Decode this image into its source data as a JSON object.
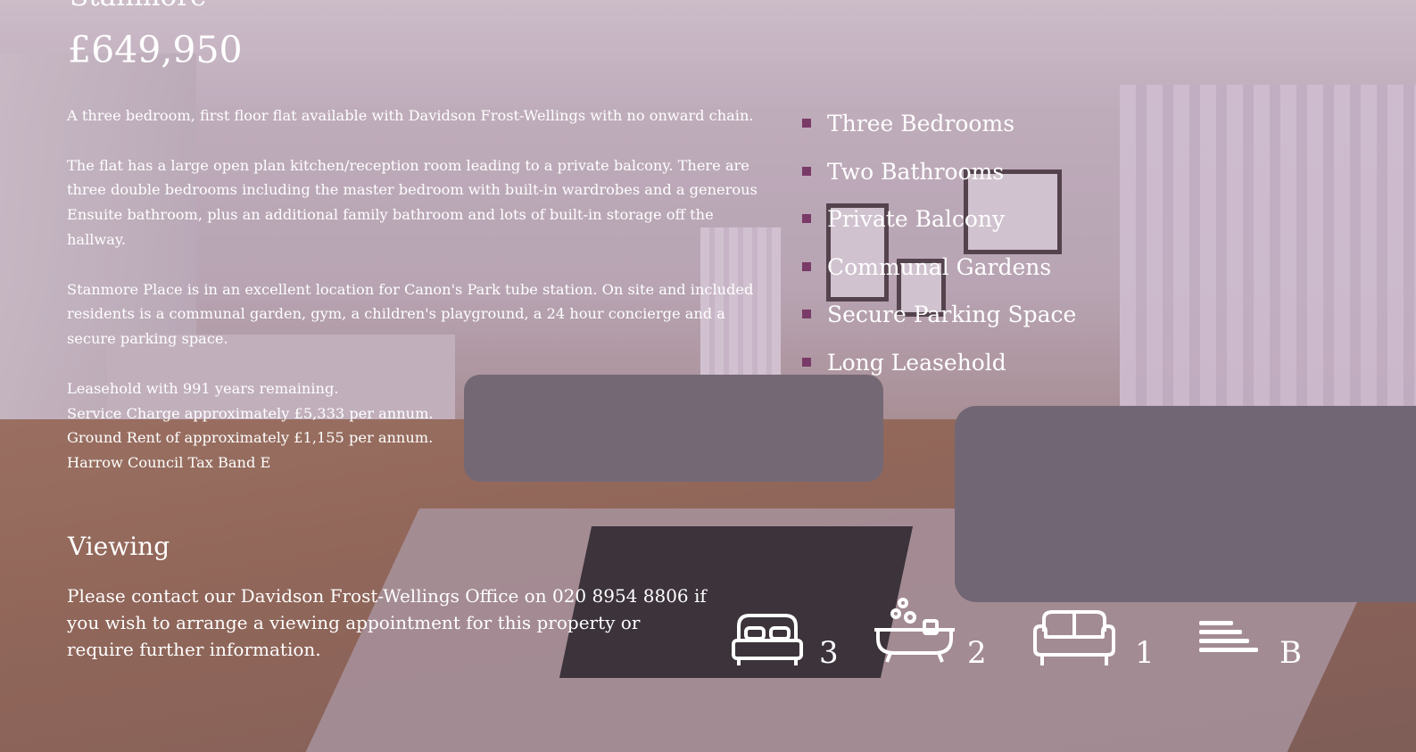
{
  "listing": {
    "location": "Stanmore",
    "price": "£649,950",
    "description": {
      "intro": "A three bedroom, first floor flat available with Davidson Frost-Wellings with no onward chain.",
      "details": "The flat has a large open plan kitchen/reception room leading to a private balcony. There are three double bedrooms including the master bedroom with built-in wardrobes and a generous Ensuite bathroom, plus an additional family bathroom and lots of built-in storage off the hallway.",
      "location_text": "Stanmore Place is in an excellent location for Canon's Park tube station. On site and included residents is a communal garden, gym, a children's playground, a 24 hour concierge and a secure parking space.",
      "notes": [
        "Leasehold with 991 years remaining.",
        "Service Charge approximately £5,333 per annum.",
        "Ground Rent of approximately £1,155 per annum.",
        "Harrow Council Tax Band E"
      ]
    },
    "features": [
      "Three Bedrooms",
      "Two Bathrooms",
      "Private Balcony",
      "Communal Gardens",
      "Secure Parking Space",
      "Long Leasehold"
    ],
    "viewing": {
      "title": "Viewing",
      "text": "Please contact our Davidson Frost-Wellings Office on 020 8954 8806 if you wish to arrange a viewing appointment for this property or require further information."
    },
    "stats": {
      "bedrooms": "3",
      "bathrooms": "2",
      "receptions": "1",
      "council_tax_band": "B"
    }
  },
  "colors": {
    "bullet": "#7a3a67",
    "text": "#ffffff"
  },
  "icons": [
    "bed-icon",
    "bath-icon",
    "sofa-icon",
    "tax-band-icon"
  ]
}
